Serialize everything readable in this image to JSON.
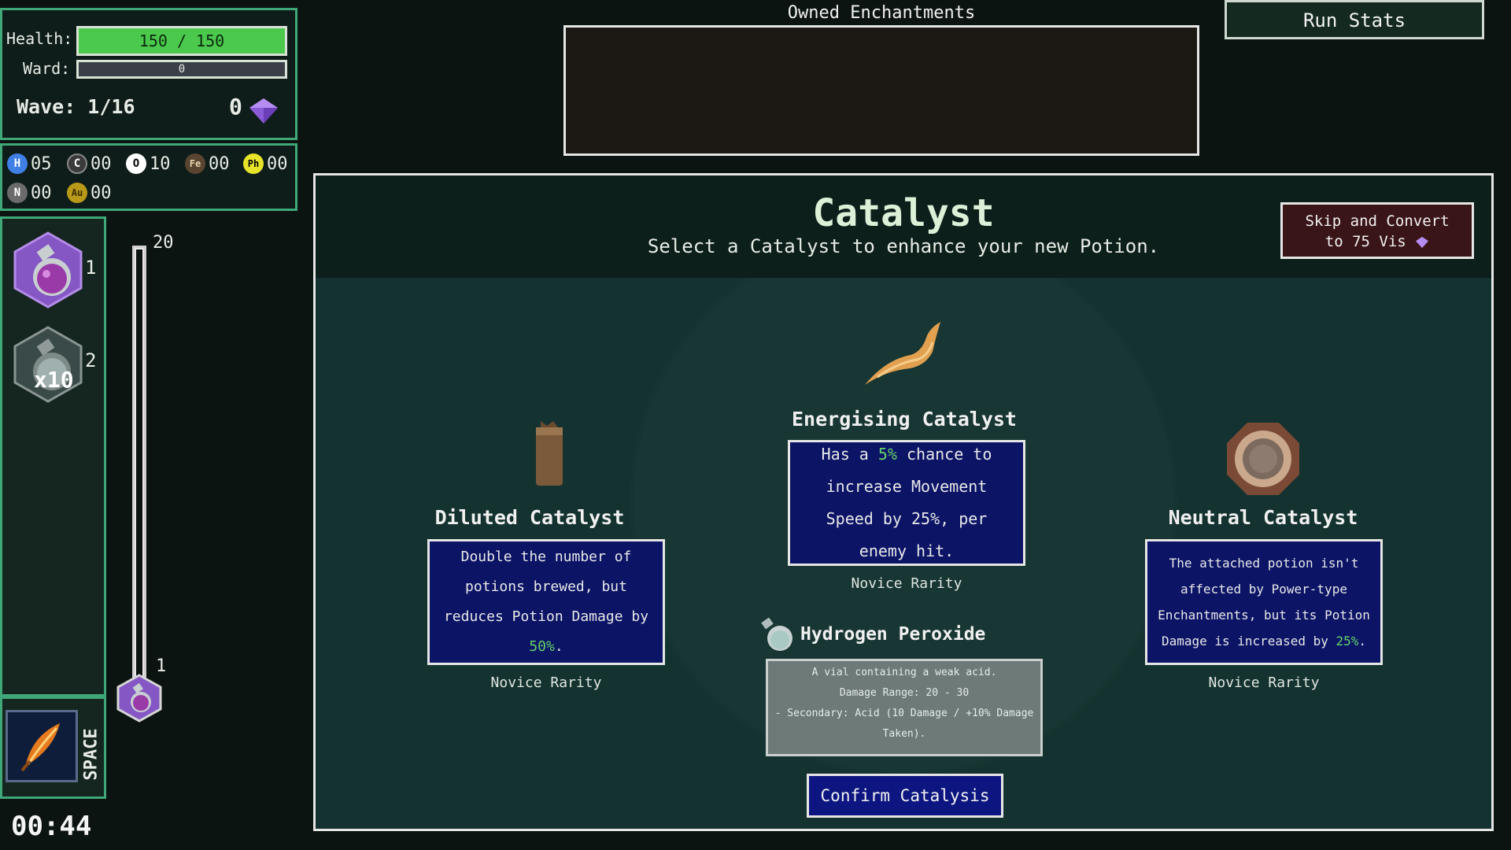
{
  "stats": {
    "health_label": "Health:",
    "health_value": "150 / 150",
    "health_fraction": 1.0,
    "ward_label": "Ward:",
    "ward_value": "0",
    "wave_label": "Wave: 1/16",
    "vis_count": "0"
  },
  "elements": [
    {
      "symbol": "H",
      "count": "05",
      "color": "#3f7fe6"
    },
    {
      "symbol": "C",
      "count": "00",
      "color": "#3a3a3a"
    },
    {
      "symbol": "O",
      "count": "10",
      "color": "#ffffff"
    },
    {
      "symbol": "Fe",
      "count": "00",
      "color": "#5a4530"
    },
    {
      "symbol": "Ph",
      "count": "00",
      "color": "#e6e32a"
    },
    {
      "symbol": "N",
      "count": "00",
      "color": "#6b6b6b"
    },
    {
      "symbol": "Au",
      "count": "00",
      "color": "#b89a18"
    }
  ],
  "inventory": {
    "slot1_key": "1",
    "slot2_key": "2",
    "slot2_count": "x10",
    "queue_top": "20",
    "queue_bottom": "1",
    "skill_key": "SPACE"
  },
  "timer": "00:44",
  "owned_title": "Owned Enchantments",
  "run_stats": "Run Stats",
  "catalyst": {
    "title": "Catalyst",
    "subtitle": "Select a Catalyst to enhance your new Potion.",
    "skip_line1": "Skip and Convert",
    "skip_line2": "to 75 Vis",
    "options": [
      {
        "name": "Diluted Catalyst",
        "desc_parts": [
          "Double the number of potions brewed, but reduces Potion Damage by ",
          "50%",
          "."
        ],
        "rarity": "Novice Rarity"
      },
      {
        "name": "Energising Catalyst",
        "desc_parts": [
          "Has a ",
          "5%",
          " chance to increase Movement Speed by 25%, per enemy hit."
        ],
        "rarity": "Novice Rarity"
      },
      {
        "name": "Neutral Catalyst",
        "desc_parts": [
          "The attached potion isn't affected by Power-type Enchantments, but its Potion Damage is increased by ",
          "25%",
          "."
        ],
        "rarity": "Novice Rarity"
      }
    ],
    "potion": {
      "name": "Hydrogen Peroxide",
      "line1": "A vial containing a weak acid.",
      "line2": "Damage Range: 20 - 30",
      "line3": "- Secondary: Acid (10 Damage / +10% Damage",
      "line4": "Taken)."
    },
    "confirm": "Confirm Catalysis"
  },
  "colors": {
    "accent": "#3fa778",
    "panel": "#143330",
    "card": "#0c1466",
    "highlight": "#63d36b",
    "vis": "#9b6fe0"
  }
}
